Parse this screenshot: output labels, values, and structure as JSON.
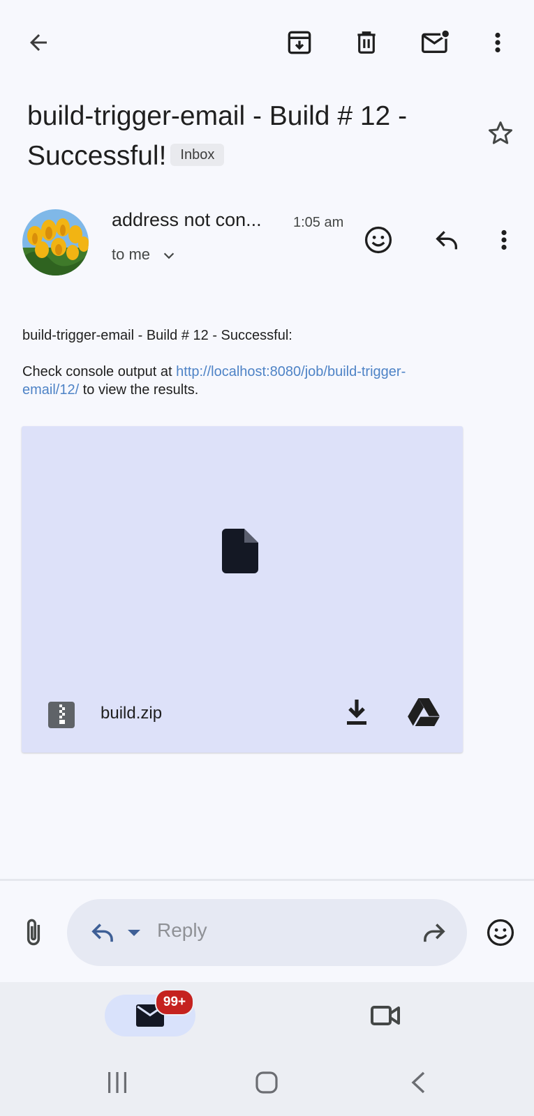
{
  "toolbar": {
    "back_icon": "arrow-left-icon",
    "archive_icon": "archive-icon",
    "delete_icon": "trash-icon",
    "mark_unread_icon": "mail-unread-icon",
    "more_icon": "more-vert-icon"
  },
  "email": {
    "subject": "build-trigger-email - Build # 12 - Successful!",
    "label": "Inbox",
    "starred": false,
    "sender": "address not con...",
    "time": "1:05 am",
    "recipient_text": "to me",
    "body_line1": "build-trigger-email - Build # 12 - Successful:",
    "body_line2_prefix": "Check console output at ",
    "body_link": "http://localhost:8080/job/build-trigger-email/12/",
    "body_line2_suffix": " to view the results."
  },
  "attachment": {
    "filename": "build.zip",
    "file_icon": "file-icon",
    "zip_icon": "zip-icon",
    "download_icon": "download-icon",
    "drive_icon": "google-drive-icon"
  },
  "reply_bar": {
    "placeholder": "Reply"
  },
  "bottom_nav": {
    "mail_badge": "99+"
  },
  "colors": {
    "background": "#f7f8fd",
    "attachment_bg": "#dde1f9",
    "link": "#4e83c6",
    "badge": "#c5221f"
  }
}
